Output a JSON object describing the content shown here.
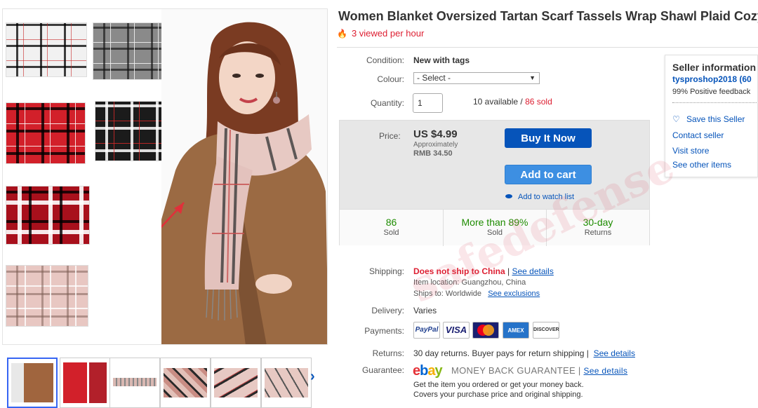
{
  "title": "Women Blanket Oversized Tartan Scarf Tassels Wrap Shawl Plaid Cozy Q",
  "viewed": "3 viewed per hour",
  "condition": {
    "label": "Condition:",
    "value": "New with tags"
  },
  "colour": {
    "label": "Colour:",
    "value": "- Select -"
  },
  "quantity": {
    "label": "Quantity:",
    "value": "1",
    "available": "10 available",
    "sep": " / ",
    "sold": "86 sold"
  },
  "price": {
    "label": "Price:",
    "value": "US $4.99",
    "approx_label": "Approximately",
    "approx_value": "RMB 34.50",
    "buy_label": "Buy It Now",
    "cart_label": "Add to cart",
    "watch_label": "Add to watch list"
  },
  "stats": [
    {
      "big": "86",
      "small": "Sold"
    },
    {
      "big": "More than 89%",
      "small": "Sold"
    },
    {
      "big": "30-day",
      "small": "Returns"
    }
  ],
  "shipping": {
    "label": "Shipping:",
    "value": "Does not ship to China",
    "sep": " | ",
    "details_link": "See details",
    "location": "Item location:  Guangzhou, China",
    "ships_to": "Ships to:  Worldwide",
    "exclusions_link": "See exclusions"
  },
  "delivery": {
    "label": "Delivery:",
    "value": "Varies"
  },
  "payments": {
    "label": "Payments:",
    "methods": [
      "PayPal",
      "VISA",
      "MasterCard",
      "AMEX",
      "DISCOVER"
    ]
  },
  "returns": {
    "label": "Returns:",
    "value": "30 day returns. Buyer pays for return shipping | ",
    "link": "See details"
  },
  "guarantee": {
    "label": "Guarantee:",
    "logo": "ebay",
    "text": "MONEY BACK GUARANTEE",
    "sep": " | ",
    "link": "See details",
    "line1": "Get the item you ordered or get your money back.",
    "line2": "Covers your purchase price and original shipping."
  },
  "seller": {
    "title": "Seller information",
    "name": "tysproshop2018",
    "count": "(60",
    "feedback": "99% Positive feedback",
    "save": "Save this Seller",
    "contact": "Contact seller",
    "store": "Visit store",
    "other": "See other items"
  },
  "watermark": "safedefense",
  "colors": {
    "link": "#0654ba",
    "buy": "#0654ba",
    "cart": "#3d8fe2",
    "alert": "#dd1e31",
    "stat": "#1e8c00"
  },
  "icons": [
    "fire-icon",
    "chevron-down-icon",
    "eye-icon",
    "heart-icon",
    "chevron-right-icon"
  ]
}
